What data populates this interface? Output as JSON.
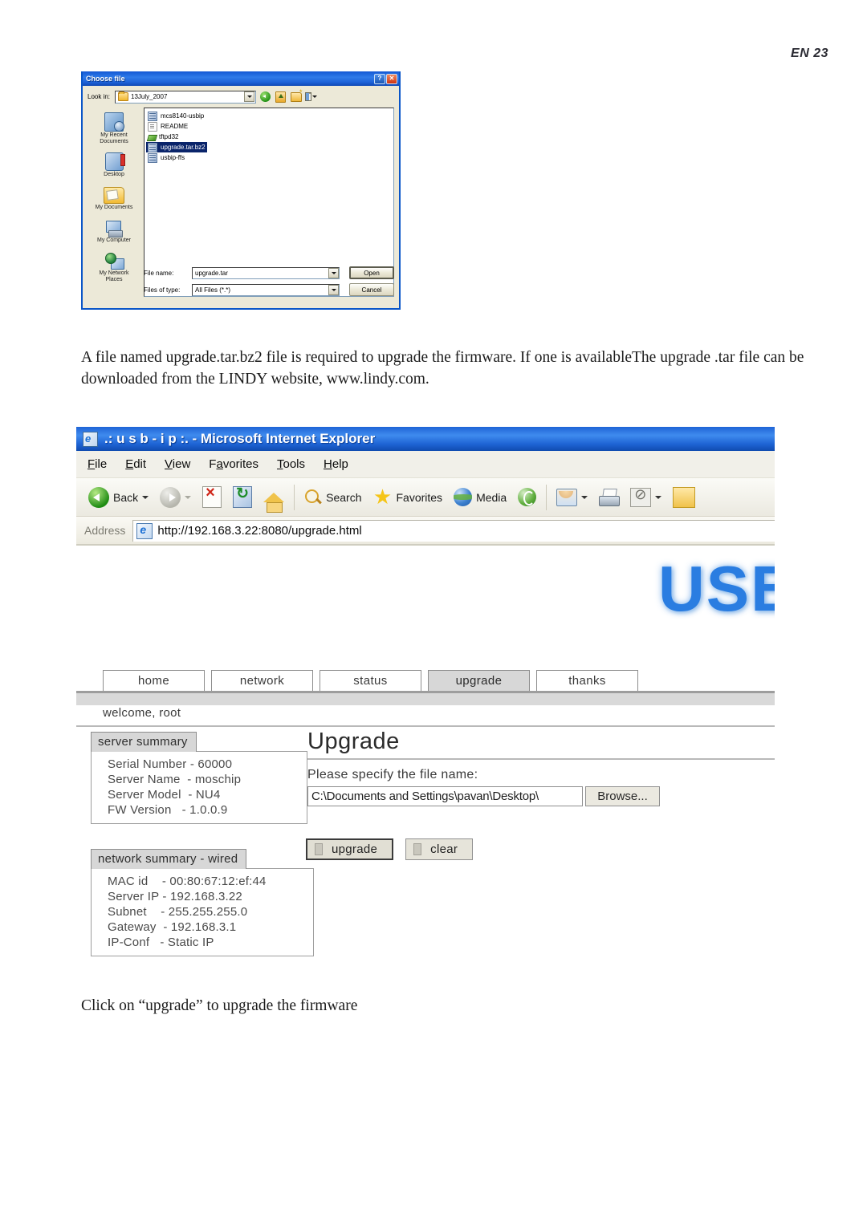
{
  "page": {
    "header_label": "EN 23",
    "paragraph_1": "A file named  upgrade.tar.bz2 file is required to upgrade the firmware. If one is availableThe upgrade .tar file can be downloaded from the LINDY website,  www.lindy.com.",
    "paragraph_2": "Click on “upgrade” to upgrade the firmware"
  },
  "choose_file_dialog": {
    "title": "Choose file",
    "help_button": "?",
    "close_button": "✕",
    "look_in_label": "Look in:",
    "look_in_value": "13July_2007",
    "toolbar_icons": [
      "back-icon",
      "up-one-level-icon",
      "new-folder-icon",
      "views-icon"
    ],
    "places": [
      {
        "label": "My Recent\nDocuments",
        "icon": "my-recent-documents-icon"
      },
      {
        "label": "Desktop",
        "icon": "desktop-icon"
      },
      {
        "label": "My Documents",
        "icon": "my-documents-icon"
      },
      {
        "label": "My Computer",
        "icon": "my-computer-icon"
      },
      {
        "label": "My Network\nPlaces",
        "icon": "my-network-places-icon"
      }
    ],
    "files": [
      {
        "name": "mcs8140-usbip",
        "icon": "archive-file-icon",
        "selected": false
      },
      {
        "name": "README",
        "icon": "text-document-icon",
        "selected": false
      },
      {
        "name": "tftpd32",
        "icon": "application-icon",
        "selected": false
      },
      {
        "name": "upgrade.tar.bz2",
        "icon": "archive-file-icon",
        "selected": true
      },
      {
        "name": "usbip-ffs",
        "icon": "archive-file-icon",
        "selected": false
      }
    ],
    "file_name_label": "File name:",
    "file_name_value": "upgrade.tar",
    "files_of_type_label": "Files of type:",
    "files_of_type_value": "All Files (*.*)",
    "open_button": "Open",
    "cancel_button": "Cancel"
  },
  "browser": {
    "window_title": ".: u s b - i p :. - Microsoft Internet Explorer",
    "menus": [
      "File",
      "Edit",
      "View",
      "Favorites",
      "Tools",
      "Help"
    ],
    "toolbar": {
      "back_label": "Back",
      "search_label": "Search",
      "favorites_label": "Favorites",
      "media_label": "Media",
      "icons": [
        "back-icon",
        "forward-icon",
        "stop-icon",
        "refresh-icon",
        "home-icon",
        "search-icon",
        "favorites-star-icon",
        "media-icon",
        "history-icon",
        "mail-icon",
        "print-icon",
        "edit-icon",
        "blocked-icon"
      ]
    },
    "address": {
      "label": "Address",
      "url": "http://192.168.3.22:8080/upgrade.html"
    }
  },
  "webpage": {
    "logo_text": "USB",
    "logo_color": "#2a7de1",
    "tabs": [
      {
        "label": "home",
        "active": false
      },
      {
        "label": "network",
        "active": false
      },
      {
        "label": "status",
        "active": false
      },
      {
        "label": "upgrade",
        "active": true
      },
      {
        "label": "thanks",
        "active": false
      }
    ],
    "welcome": "welcome, root",
    "server_summary": {
      "tab_label": "server summary",
      "rows": [
        "Serial Number - 60000",
        "Server Name  - moschip",
        "Server Model  - NU4",
        "FW Version   - 1.0.0.9"
      ]
    },
    "network_summary": {
      "tab_label": "network summary - wired",
      "rows": [
        "MAC id    - 00:80:67:12:ef:44",
        "Server IP - 192.168.3.22",
        "Subnet    - 255.255.255.0",
        "Gateway  - 192.168.3.1",
        "IP-Conf   - Static IP"
      ]
    },
    "main": {
      "heading": "Upgrade",
      "file_prompt": "Please specify the file name:",
      "file_value": "C:\\Documents and Settings\\pavan\\Desktop\\",
      "browse_button": "Browse...",
      "upgrade_button": "upgrade",
      "clear_button": "clear"
    }
  }
}
